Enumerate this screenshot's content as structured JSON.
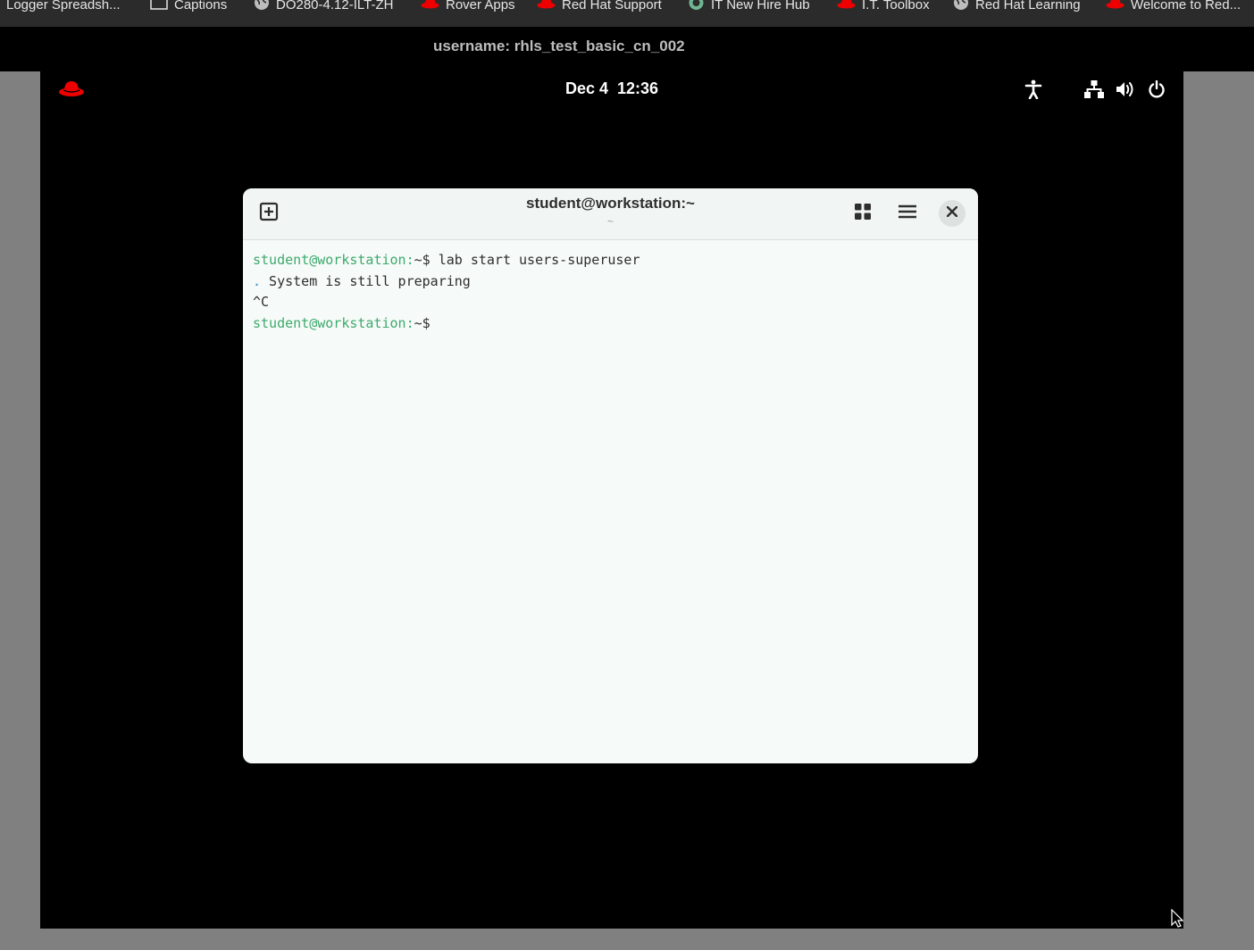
{
  "bookmarks": [
    {
      "label": "Logger Spreadsh...",
      "icon": "none"
    },
    {
      "label": "Captions",
      "icon": "folder-icon"
    },
    {
      "label": "DO280-4.12-ILT-ZH",
      "icon": "globe-icon"
    },
    {
      "label": "Rover Apps",
      "icon": "redhat-icon"
    },
    {
      "label": "Red Hat Support",
      "icon": "redhat-icon"
    },
    {
      "label": "IT New Hire Hub",
      "icon": "hub-icon"
    },
    {
      "label": "I.T. Toolbox",
      "icon": "redhat-icon"
    },
    {
      "label": "Red Hat Learning",
      "icon": "globe-icon"
    },
    {
      "label": "Welcome to Red...",
      "icon": "redhat-icon"
    }
  ],
  "banner": {
    "username_text": "username: rhls_test_basic_cn_002"
  },
  "topbar": {
    "clock": "Dec 4  12:36",
    "icons": [
      "accessibility-icon",
      "network-icon",
      "volume-icon",
      "power-icon"
    ]
  },
  "terminal": {
    "title": "student@workstation:~",
    "subtitle": "~",
    "lines": [
      {
        "prompt": "student@workstation:",
        "path": "~$ ",
        "text": "lab start users-superuser"
      },
      {
        "prefix": ".",
        "text": " System is still preparing"
      },
      {
        "text": "^C"
      },
      {
        "prompt": "student@workstation:",
        "path": "~$ ",
        "text": ""
      }
    ]
  },
  "colors": {
    "accent_red": "#ee0000",
    "prompt_green": "#3daa6d",
    "terminal_bg": "#f6faf8",
    "banner_bg": "#000000",
    "bookmarks_bg": "#2b2b2b"
  }
}
